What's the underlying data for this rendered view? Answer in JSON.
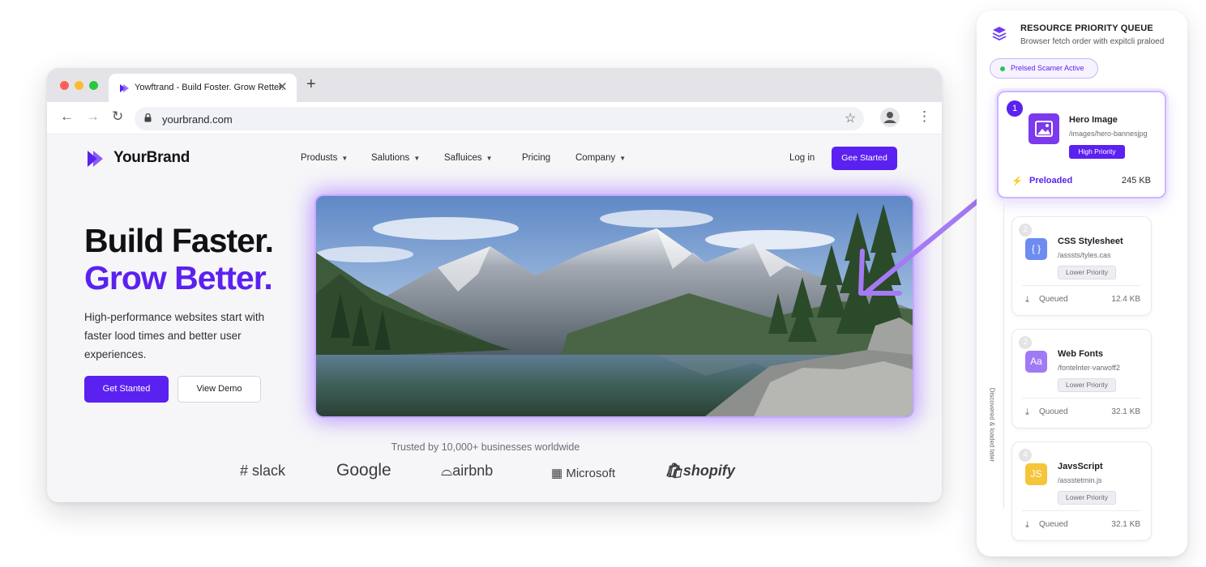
{
  "browser": {
    "tab_title": "Yowftrand - Build Foster. Grow Retter.",
    "url": "yourbrand.com"
  },
  "site": {
    "brand": "YourBrand",
    "nav": [
      {
        "label": "Produsts",
        "has_chevron": true
      },
      {
        "label": "Salutions",
        "has_chevron": true
      },
      {
        "label": "Safluices",
        "has_chevron": true
      },
      {
        "label": "Pricing",
        "has_chevron": false
      },
      {
        "label": "Company",
        "has_chevron": true
      }
    ],
    "login_label": "Log in",
    "cta_top_label": "Gee Started",
    "headline_line1": "Build Faster.",
    "headline_line2": "Grow Better.",
    "lead": "High-performance websites start with faster lood times and better user experiences.",
    "cta_primary": "Get Stanted",
    "cta_secondary": "View Demo",
    "trusted": "Trusted by 10,000+ businesses worldwide",
    "logos": [
      "slack",
      "Google",
      "airbnb",
      "Microsoft",
      "shopify"
    ]
  },
  "panel": {
    "title": "RESOURCE PRIORITY QUEUE",
    "subtitle": "Browser fetch order with expitcli praloed",
    "status": "Prelsed Scamer Active",
    "side_label": "Discovered & loaded later",
    "items": [
      {
        "num": "1",
        "name": "Hero Image",
        "path": "/images/hero-bannesjpg",
        "priority": "High Priority",
        "state": "Preloaded",
        "size": "245 KB",
        "icon_text": "",
        "icon_bg": "#7c3aed",
        "icon_color": "#ffffff"
      },
      {
        "num": "2",
        "name": "CSS Stylesheet",
        "path": "/asssts/tyles.cas",
        "priority": "Lower Priority",
        "state": "Queued",
        "size": "12.4 KB",
        "icon_text": "{ }",
        "icon_bg": "#e0e7ff",
        "icon_color": "#4f46e5"
      },
      {
        "num": "2",
        "name": "Web Fonts",
        "path": "/fontelnter-varwoff2",
        "priority": "Lower Priority",
        "state": "Quoued",
        "size": "32.1 KB",
        "icon_text": "Aa",
        "icon_bg": "#ede4ff",
        "icon_color": "#7c3aed"
      },
      {
        "num": "4",
        "name": "JavsScript",
        "path": "/assstetmin.js",
        "priority": "Lower Priority",
        "state": "Queued",
        "size": "32.1 KB",
        "icon_text": "JS",
        "icon_bg": "#fcd34d",
        "icon_color": "#ffffff"
      }
    ]
  },
  "colors": {
    "accent": "#5b21f0",
    "accent_soft": "#c5a9ff",
    "status_green": "#22c55e"
  }
}
